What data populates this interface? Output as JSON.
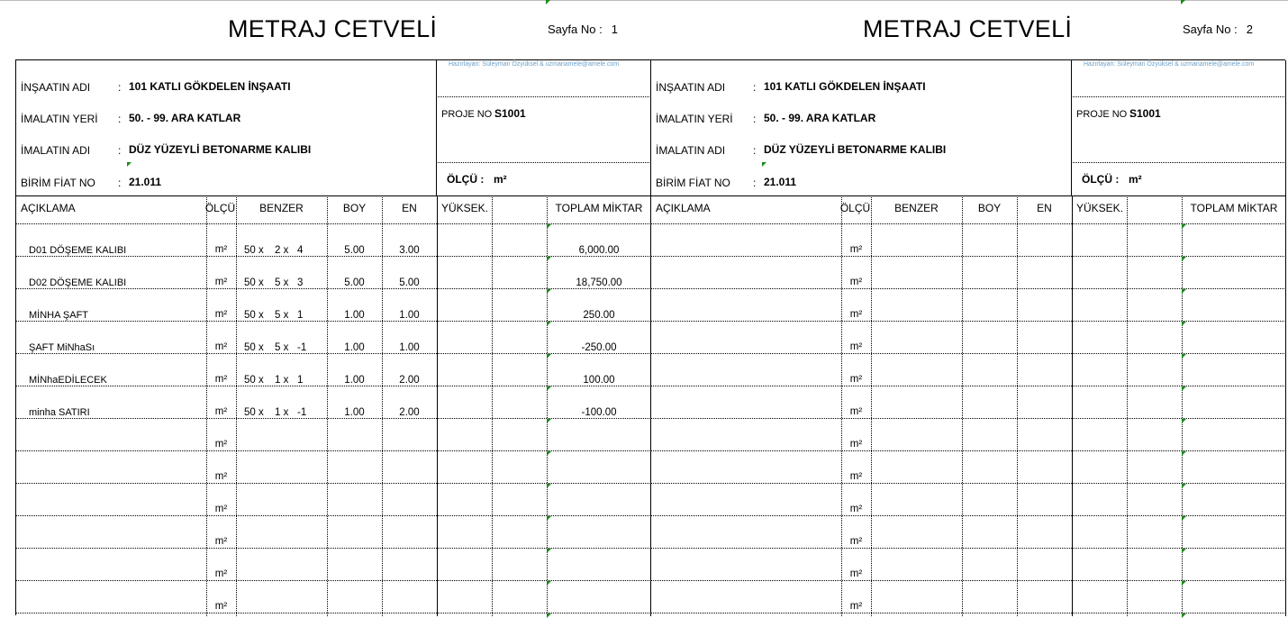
{
  "pages": [
    {
      "title": "METRAJ CETVELİ",
      "page_label": "Sayfa No :",
      "page_number": "1",
      "credit": "Hazırlayan: Süleyman Özyüksel & uzmanamele@amele.com",
      "info": {
        "insaat_label": "İNŞAATIN ADI",
        "insaat_value": "101 KATLI GÖKDELEN İNŞAATI",
        "yer_label": "İMALATIN YERİ",
        "yer_value": "50. - 99. ARA KATLAR",
        "imalat_label": "İMALATIN ADI",
        "imalat_value": "DÜZ YÜZEYLİ BETONARME KALIBI",
        "fiat_label": "BİRİM FİAT NO",
        "fiat_value": "21.011",
        "colon": ":",
        "proje_label": "PROJE NO :",
        "proje_value": "S1001",
        "olcu_label": "ÖLÇÜ :",
        "olcu_value": "m²"
      },
      "columns": [
        "AÇIKLAMA",
        "ÖLÇÜ",
        "BENZER",
        "BOY",
        "EN",
        "YÜKSEK.",
        "",
        "TOPLAM MİKTAR"
      ],
      "rows": [
        {
          "desc": "D01 DÖŞEME KALIBI",
          "unit": "m²",
          "b1": "50 x",
          "b2": "2 x",
          "b3": "4",
          "boy": "5.00",
          "en": "3.00",
          "total": "6,000.00"
        },
        {
          "desc": "D02 DÖŞEME KALIBI",
          "unit": "m²",
          "b1": "50 x",
          "b2": "5 x",
          "b3": "3",
          "boy": "5.00",
          "en": "5.00",
          "total": "18,750.00"
        },
        {
          "desc": "MİNHA ŞAFT",
          "unit": "m²",
          "b1": "50 x",
          "b2": "5 x",
          "b3": "1",
          "boy": "1.00",
          "en": "1.00",
          "total": "250.00"
        },
        {
          "desc": "ŞAFT MiNhaSı",
          "unit": "m²",
          "b1": "50 x",
          "b2": "5 x",
          "b3": "-1",
          "boy": "1.00",
          "en": "1.00",
          "total": "-250.00"
        },
        {
          "desc": "MİNhaEDİLECEK",
          "unit": "m²",
          "b1": "50 x",
          "b2": "1 x",
          "b3": "1",
          "boy": "1.00",
          "en": "2.00",
          "total": "100.00"
        },
        {
          "desc": "minha SATIRI",
          "unit": "m²",
          "b1": "50 x",
          "b2": "1 x",
          "b3": "-1",
          "boy": "1.00",
          "en": "2.00",
          "total": "-100.00"
        },
        {
          "desc": "",
          "unit": "m²",
          "b1": "",
          "b2": "",
          "b3": "",
          "boy": "",
          "en": "",
          "total": ""
        },
        {
          "desc": "",
          "unit": "m²",
          "b1": "",
          "b2": "",
          "b3": "",
          "boy": "",
          "en": "",
          "total": ""
        },
        {
          "desc": "",
          "unit": "m²",
          "b1": "",
          "b2": "",
          "b3": "",
          "boy": "",
          "en": "",
          "total": ""
        },
        {
          "desc": "",
          "unit": "m²",
          "b1": "",
          "b2": "",
          "b3": "",
          "boy": "",
          "en": "",
          "total": ""
        },
        {
          "desc": "",
          "unit": "m²",
          "b1": "",
          "b2": "",
          "b3": "",
          "boy": "",
          "en": "",
          "total": ""
        },
        {
          "desc": "",
          "unit": "m²",
          "b1": "",
          "b2": "",
          "b3": "",
          "boy": "",
          "en": "",
          "total": ""
        }
      ]
    },
    {
      "title": "METRAJ CETVELİ",
      "page_label": "Sayfa No :",
      "page_number": "2",
      "credit": "Hazırlayan: Süleyman Özyüksel & uzmanamele@amele.com",
      "info": {
        "insaat_label": "İNŞAATIN ADI",
        "insaat_value": "101 KATLI GÖKDELEN İNŞAATI",
        "yer_label": "İMALATIN YERİ",
        "yer_value": "50. - 99. ARA KATLAR",
        "imalat_label": "İMALATIN ADI",
        "imalat_value": "DÜZ YÜZEYLİ BETONARME KALIBI",
        "fiat_label": "BİRİM FİAT NO",
        "fiat_value": "21.011",
        "colon": ":",
        "proje_label": "PROJE NO :",
        "proje_value": "S1001",
        "olcu_label": "ÖLÇÜ :",
        "olcu_value": "m²"
      },
      "columns": [
        "AÇIKLAMA",
        "ÖLÇÜ",
        "BENZER",
        "BOY",
        "EN",
        "YÜKSEK.",
        "",
        "TOPLAM MİKTAR"
      ],
      "rows": [
        {
          "desc": "",
          "unit": "m²",
          "b1": "",
          "b2": "",
          "b3": "",
          "boy": "",
          "en": "",
          "total": ""
        },
        {
          "desc": "",
          "unit": "m²",
          "b1": "",
          "b2": "",
          "b3": "",
          "boy": "",
          "en": "",
          "total": ""
        },
        {
          "desc": "",
          "unit": "m²",
          "b1": "",
          "b2": "",
          "b3": "",
          "boy": "",
          "en": "",
          "total": ""
        },
        {
          "desc": "",
          "unit": "m²",
          "b1": "",
          "b2": "",
          "b3": "",
          "boy": "",
          "en": "",
          "total": ""
        },
        {
          "desc": "",
          "unit": "m²",
          "b1": "",
          "b2": "",
          "b3": "",
          "boy": "",
          "en": "",
          "total": ""
        },
        {
          "desc": "",
          "unit": "m²",
          "b1": "",
          "b2": "",
          "b3": "",
          "boy": "",
          "en": "",
          "total": ""
        },
        {
          "desc": "",
          "unit": "m²",
          "b1": "",
          "b2": "",
          "b3": "",
          "boy": "",
          "en": "",
          "total": ""
        },
        {
          "desc": "",
          "unit": "m²",
          "b1": "",
          "b2": "",
          "b3": "",
          "boy": "",
          "en": "",
          "total": ""
        },
        {
          "desc": "",
          "unit": "m²",
          "b1": "",
          "b2": "",
          "b3": "",
          "boy": "",
          "en": "",
          "total": ""
        },
        {
          "desc": "",
          "unit": "m²",
          "b1": "",
          "b2": "",
          "b3": "",
          "boy": "",
          "en": "",
          "total": ""
        },
        {
          "desc": "",
          "unit": "m²",
          "b1": "",
          "b2": "",
          "b3": "",
          "boy": "",
          "en": "",
          "total": ""
        },
        {
          "desc": "",
          "unit": "m²",
          "b1": "",
          "b2": "",
          "b3": "",
          "boy": "",
          "en": "",
          "total": ""
        }
      ]
    }
  ]
}
